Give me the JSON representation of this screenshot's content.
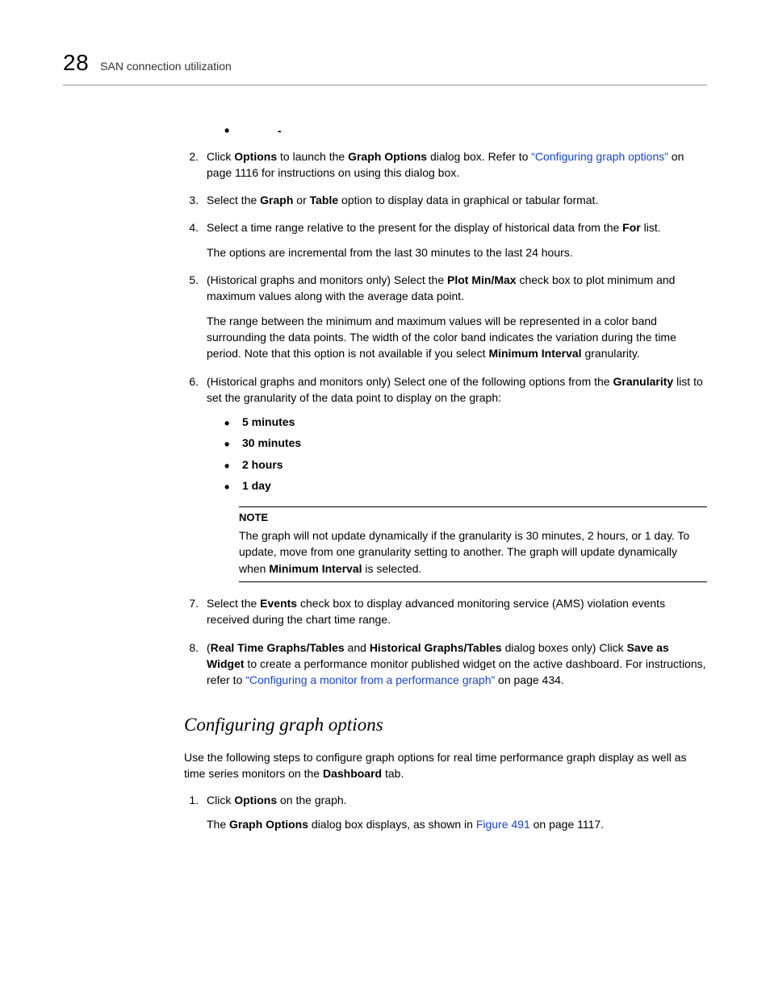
{
  "header": {
    "page_number": "28",
    "title": "SAN connection utilization"
  },
  "steps": {
    "s2": {
      "num": "2.",
      "t1": "Click ",
      "b1": "Options",
      "t2": " to launch the ",
      "b2": "Graph Options",
      "t3": " dialog box. Refer to ",
      "link": "“Configuring graph options”",
      "t4": " on page 1116 for instructions on using this dialog box."
    },
    "s3": {
      "num": "3.",
      "t1": "Select the ",
      "b1": "Graph",
      "t2": " or ",
      "b2": "Table",
      "t3": " option to display data in graphical or tabular format."
    },
    "s4": {
      "num": "4.",
      "line1a": "Select a time range relative to the present for the display of historical data from the ",
      "b1": "For",
      "line1b": " list.",
      "line2": "The options are incremental from the last 30 minutes to the last 24 hours."
    },
    "s5": {
      "num": "5.",
      "line1a": "(Historical graphs and monitors only) Select the ",
      "b1": "Plot Min/Max",
      "line1b": " check box to plot minimum and maximum values along with the average data point.",
      "line2a": "The range between the minimum and maximum values will be represented in a color band surrounding the data points. The width of the color band indicates the variation during the time period. Note that this option is not available if you select ",
      "b2": "Minimum Interval",
      "line2b": " granularity."
    },
    "s6": {
      "num": "6.",
      "line1a": "(Historical graphs and monitors only) Select one of the following options from the ",
      "b1": "Granularity",
      "line1b": " list to set the granularity of the data point to display on the graph:",
      "bullets": [
        "5 minutes",
        "30 minutes",
        "2 hours",
        "1 day"
      ],
      "note_title": "NOTE",
      "note_a": "The graph will not update dynamically if the granularity is 30 minutes, 2 hours, or 1 day. To update, move from one granularity setting to another. The graph will update dynamically when ",
      "note_b": "Minimum Interval",
      "note_c": " is selected."
    },
    "s7": {
      "num": "7.",
      "t1": "Select the ",
      "b1": "Events",
      "t2": " check box to display advanced monitoring service (AMS) violation events received during the chart time range."
    },
    "s8": {
      "num": "8.",
      "t1": "(",
      "b1": "Real Time Graphs/Tables",
      "t2": " and ",
      "b2": "Historical Graphs/Tables",
      "t3": " dialog boxes only) Click ",
      "b3": "Save as Widget",
      "t4": " to create a performance monitor published widget on the active dashboard. For instructions, refer to ",
      "link": "“Configuring a monitor from a performance graph”",
      "t5": " on page 434."
    }
  },
  "section2": {
    "heading": "Configuring graph options",
    "intro_a": "Use the following steps to configure graph options for real time performance graph display as well as time series monitors on the ",
    "intro_b": "Dashboard",
    "intro_c": " tab.",
    "s1": {
      "num": "1.",
      "t1": "Click ",
      "b1": "Options",
      "t2": " on the graph.",
      "line2a": "The ",
      "b2": "Graph Options",
      "line2b": " dialog box displays, as shown in ",
      "link": "Figure 491",
      "line2c": " on page 1117."
    }
  }
}
